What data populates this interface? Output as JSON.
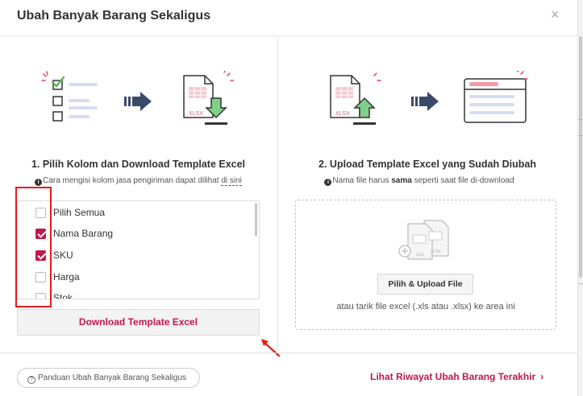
{
  "modal": {
    "title": "Ubah Banyak Barang Sekaligus",
    "close_icon": "×"
  },
  "step1": {
    "title": "1. Pilih Kolom dan Download Template Excel",
    "note_before": "Cara mengisi kolom jasa pengiriman dapat dilihat ",
    "note_link": "di sini",
    "columns": [
      {
        "label": "Pilih Semua",
        "checked": false
      },
      {
        "label": "Nama Barang",
        "checked": true
      },
      {
        "label": "SKU",
        "checked": true
      },
      {
        "label": "Harga",
        "checked": false
      },
      {
        "label": "Stok",
        "checked": false
      }
    ],
    "download_label": "Download Template Excel"
  },
  "step2": {
    "title": "2. Upload Template Excel yang Sudah Diubah",
    "note_before": "Nama file harus ",
    "note_bold": "sama",
    "note_after": " seperti saat file di-download",
    "upload_label": "Pilih & Upload File",
    "drop_hint": "atau tarik file excel (.xls atau .xlsx) ke area ini"
  },
  "footer": {
    "guide_label": "Panduan Ubah Banyak Barang Sekaligus",
    "history_label": "Lihat Riwayat Ubah Barang Terakhir",
    "history_chevron": "›"
  },
  "illustration": {
    "file_tag": "XLSX"
  },
  "colors": {
    "accent": "#c2184b",
    "highlight": "#e41c1c",
    "green": "#5cb85c"
  }
}
